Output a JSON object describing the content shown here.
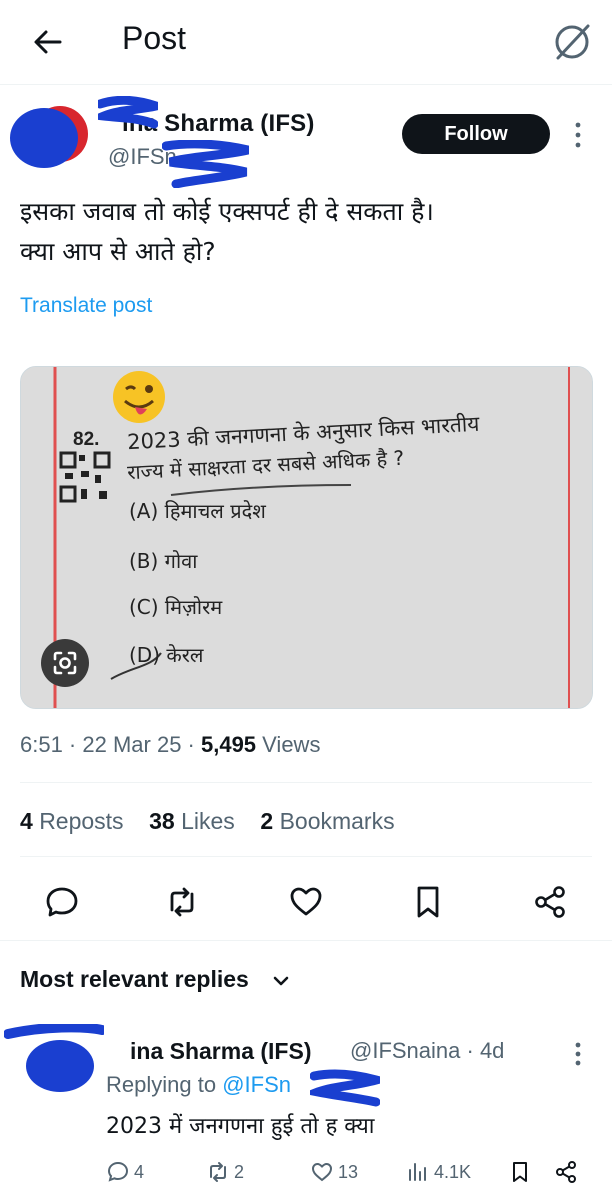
{
  "header": {
    "title": "Post",
    "back_icon": "arrow-left-icon",
    "grok_icon": "grok-icon"
  },
  "author": {
    "name": "ina Sharma (IFS)",
    "handle": "@IFSn",
    "follow_label": "Follow"
  },
  "post": {
    "text": "इसका जवाब तो कोई एक्सपर्ट ही दे सकता है।\nक्या आप से आते हो?",
    "translate_label": "Translate post"
  },
  "image": {
    "question_number": "82.",
    "question_line1": "2023 की जनगणना के अनुसार किस भारतीय",
    "question_line2": "राज्य में साक्षरता दर सबसे अधिक है ?",
    "options": [
      "(A)  हिमाचल प्रदेश",
      "(B)  गोवा",
      "(C)  मिज़ोरम",
      "(D)  केरल"
    ]
  },
  "meta": {
    "time": "6:51 · 22 Mar 25 · ",
    "views_count": "5,495",
    "views_label": " Views"
  },
  "stats": {
    "reposts_count": "4",
    "reposts_label": "Reposts",
    "likes_count": "38",
    "likes_label": "Likes",
    "bookmarks_count": "2",
    "bookmarks_label": "Bookmarks"
  },
  "replies_header": "Most relevant replies",
  "reply": {
    "name": "ina Sharma (IFS)",
    "handle_time": "@IFSnaina · 4d",
    "replying_prefix": "Replying to ",
    "replying_handle": "@IFSn",
    "text": "2023 में जनगणना हुई तो ह क्या",
    "comments": "4",
    "reposts": "2",
    "likes": "13",
    "views": "4.1K"
  },
  "colors": {
    "accent": "#1d9bf0",
    "text": "#0f1419",
    "muted": "#536471",
    "scribble": "#1a3fd0"
  }
}
